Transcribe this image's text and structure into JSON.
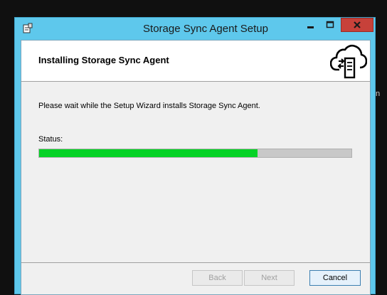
{
  "window": {
    "title": "Storage Sync Agent Setup",
    "accent_color": "#5ec8ec",
    "close_color": "#c7413a"
  },
  "header": {
    "title": "Installing Storage Sync Agent",
    "icon": "cloud-sync-icon"
  },
  "body": {
    "message": "Please wait while the Setup Wizard installs Storage Sync Agent.",
    "status_label": "Status:",
    "progress": 0.7,
    "progress_color": "#06d226"
  },
  "buttons": {
    "back": "Back",
    "next": "Next",
    "cancel": "Cancel"
  }
}
